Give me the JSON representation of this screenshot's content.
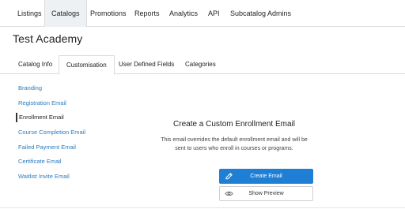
{
  "topnav": {
    "tabs": [
      {
        "label": "Listings"
      },
      {
        "label": "Catalogs"
      },
      {
        "label": "Promotions"
      },
      {
        "label": "Reports"
      },
      {
        "label": "Analytics"
      },
      {
        "label": "API"
      },
      {
        "label": "Subcatalog Admins"
      }
    ],
    "active": "Catalogs"
  },
  "page": {
    "title": "Test Academy"
  },
  "subtabs": {
    "tabs": [
      {
        "label": "Catalog Info"
      },
      {
        "label": "Customisation"
      },
      {
        "label": "User Defined Fields"
      },
      {
        "label": "Categories"
      }
    ],
    "active": "Customisation"
  },
  "sidebar": {
    "items": [
      {
        "label": "Branding"
      },
      {
        "label": "Registration Email"
      },
      {
        "label": "Enrollment Email"
      },
      {
        "label": "Course Completion Email"
      },
      {
        "label": "Failed Payment Email"
      },
      {
        "label": "Certificate Email"
      },
      {
        "label": "Waitlist Invite Email"
      }
    ],
    "active": "Enrollment Email"
  },
  "main": {
    "heading": "Create a Custom Enrollment Email",
    "description": "This email overrides the default enrollment email and will be sent to users who enroll in courses or programs.",
    "create_button": {
      "label": "Create Email",
      "icon": "pencil-icon"
    },
    "preview_button": {
      "label": "Show Preview",
      "icon": "eye-icon"
    }
  },
  "colors": {
    "link": "#2a7bbf",
    "primary_button": "#1f7fd4",
    "border": "#dcdcdc"
  }
}
